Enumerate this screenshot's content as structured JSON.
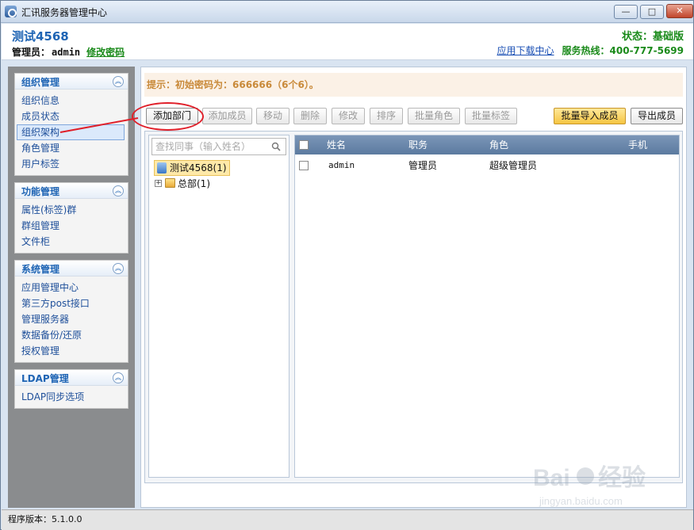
{
  "window": {
    "title": "汇讯服务器管理中心"
  },
  "header": {
    "org_name": "测试4568",
    "admin_label": "管理员：",
    "admin_name": "admin",
    "change_password": "修改密码",
    "status": "状态：基础版",
    "download_center": "应用下载中心",
    "hotline": "服务热线：400-777-5699"
  },
  "sidebar": {
    "groups": [
      {
        "title": "组织管理",
        "items": [
          "组织信息",
          "成员状态",
          "组织架构",
          "角色管理",
          "用户标签"
        ]
      },
      {
        "title": "功能管理",
        "items": [
          "属性(标签)群",
          "群组管理",
          "文件柜"
        ]
      },
      {
        "title": "系统管理",
        "items": [
          "应用管理中心",
          "第三方post接口",
          "管理服务器",
          "数据备份/还原",
          "授权管理"
        ]
      },
      {
        "title": "LDAP管理",
        "items": [
          "LDAP同步选项"
        ]
      }
    ],
    "active_item": "组织架构"
  },
  "hint": "提示：初始密码为：666666（6个6）。",
  "toolbar": {
    "add_dept": "添加部门",
    "add_member": "添加成员",
    "move": "移动",
    "delete": "删除",
    "edit": "修改",
    "sort": "排序",
    "batch_role": "批量角色",
    "batch_tag": "批量标签",
    "batch_import": "批量导入成员",
    "export": "导出成员"
  },
  "tree": {
    "search_placeholder": "查找同事（输入姓名）",
    "root": "测试4568(1)",
    "child": "总部(1)"
  },
  "grid": {
    "columns": [
      "姓名",
      "职务",
      "角色",
      "手机"
    ],
    "rows": [
      {
        "name": "admin",
        "title": "管理员",
        "role": "超级管理员",
        "phone": ""
      }
    ]
  },
  "statusbar": {
    "version": "程序版本：5.1.0.0"
  },
  "watermark": {
    "brand": "Baidu经验",
    "url": "jingyan.baidu.com"
  },
  "colors": {
    "accent": "#1e64b4",
    "green": "#1a8a1a",
    "annotation": "#e0202a"
  }
}
